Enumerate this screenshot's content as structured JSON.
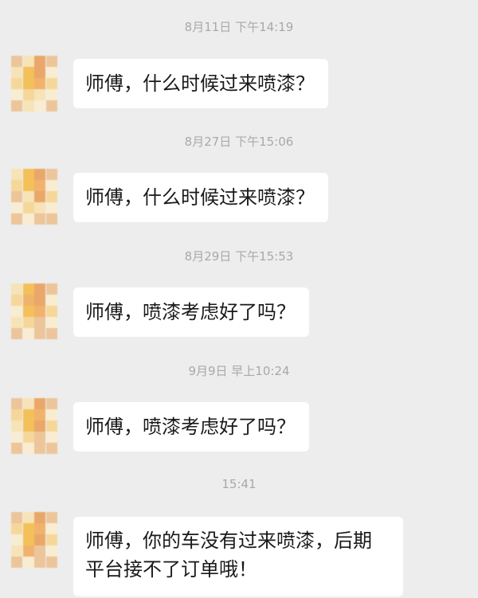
{
  "chat": {
    "messages": [
      {
        "timestamp": "8月11日 下午14:19",
        "lines": [
          "师傅，什么时候过来喷漆？"
        ]
      },
      {
        "timestamp": "8月27日 下午15:06",
        "lines": [
          "师傅，什么时候过来喷漆？"
        ]
      },
      {
        "timestamp": "8月29日 下午15:53",
        "lines": [
          "师傅，喷漆考虑好了吗？"
        ]
      },
      {
        "timestamp": "9月9日 早上10:24",
        "lines": [
          "师傅，喷漆考虑好了吗？"
        ]
      },
      {
        "timestamp": "15:41",
        "lines": [
          "师傅，你的车没有过来喷漆，后期",
          "平台接不了订单哦！"
        ]
      }
    ]
  },
  "colors": {
    "background": "#ededed",
    "bubble": "#ffffff",
    "timestamp_text": "#a9a9a9",
    "message_text": "#191919",
    "avatar_palette": [
      "#f3c05a",
      "#f5d79a",
      "#e9a86a",
      "#f7e3b8",
      "#f1b36c",
      "#f8ecd2",
      "#ecc59a"
    ]
  }
}
